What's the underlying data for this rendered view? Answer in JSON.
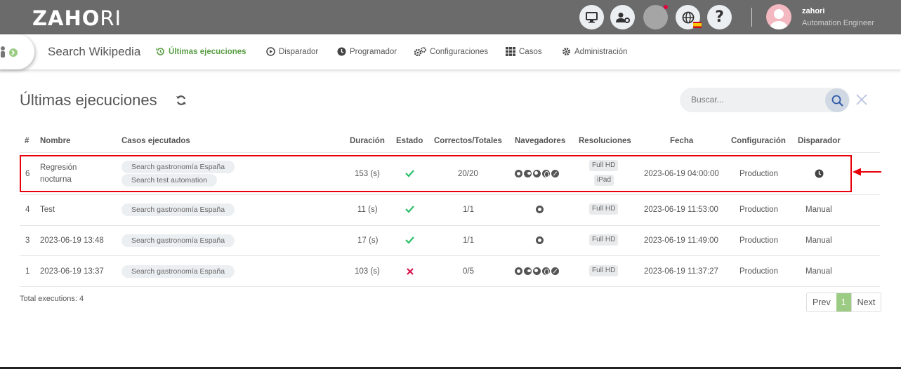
{
  "header": {
    "logo_bold": "ZAHO",
    "logo_thin": "RI",
    "user_name": "zahori",
    "user_role": "Automation Engineer"
  },
  "nav": {
    "title": "Search Wikipedia",
    "items": [
      {
        "label": "Últimas ejecuciones",
        "icon": "history-icon",
        "active": true
      },
      {
        "label": "Disparador",
        "icon": "play-icon"
      },
      {
        "label": "Programador",
        "icon": "clock-icon"
      },
      {
        "label": "Configuraciones",
        "icon": "gears-icon"
      },
      {
        "label": "Casos",
        "icon": "grid-icon"
      },
      {
        "label": "Administración",
        "icon": "gear-icon"
      }
    ]
  },
  "page": {
    "title": "Últimas ejecuciones",
    "search_placeholder": "Buscar...",
    "total": "Total executions: 4"
  },
  "table": {
    "headers": [
      "#",
      "Nombre",
      "Casos ejecutados",
      "Duración",
      "Estado",
      "Correctos/Totales",
      "Navegadores",
      "Resoluciones",
      "Fecha",
      "Configuración",
      "Disparador"
    ],
    "rows": [
      {
        "id": "6",
        "name_line1": "Regresión",
        "name_line2": "nocturna",
        "cases": [
          "Search gastronomía España",
          "Search test automation"
        ],
        "duration": "153 (s)",
        "status": "ok",
        "ratio": "20/20",
        "browsers": [
          "chrome",
          "edge",
          "firefox",
          "opera",
          "safari"
        ],
        "resolutions": [
          "Full HD",
          "iPad"
        ],
        "date": "2023-06-19 04:00:00",
        "config": "Production",
        "trigger": "",
        "trigger_icon": "clock-icon"
      },
      {
        "id": "4",
        "name_line1": "Test",
        "name_line2": "",
        "cases": [
          "Search gastronomía España"
        ],
        "duration": "11 (s)",
        "status": "ok",
        "ratio": "1/1",
        "browsers": [
          "chrome"
        ],
        "resolutions": [
          "Full HD"
        ],
        "date": "2023-06-19 11:53:00",
        "config": "Production",
        "trigger": "Manual"
      },
      {
        "id": "3",
        "name_line1": "2023-06-19 13:48",
        "name_line2": "",
        "cases": [
          "Search gastronomía España"
        ],
        "duration": "17 (s)",
        "status": "ok",
        "ratio": "1/1",
        "browsers": [
          "chrome"
        ],
        "resolutions": [
          "Full HD"
        ],
        "date": "2023-06-19 11:49:00",
        "config": "Production",
        "trigger": "Manual"
      },
      {
        "id": "1",
        "name_line1": "2023-06-19 13:37",
        "name_line2": "",
        "cases": [
          "Search gastronomía España"
        ],
        "duration": "103 (s)",
        "status": "fail",
        "ratio": "0/5",
        "browsers": [
          "chrome",
          "edge",
          "firefox",
          "opera",
          "safari"
        ],
        "resolutions": [
          "Full HD"
        ],
        "date": "2023-06-19 11:37:27",
        "config": "Production",
        "trigger": "Manual"
      }
    ]
  },
  "pagination": {
    "prev": "Prev",
    "current": "1",
    "next": "Next"
  },
  "colors": {
    "accent_green": "#5a9e45",
    "ok": "#2bbf6a",
    "fail": "#d9144b",
    "highlight": "#e8000b"
  }
}
